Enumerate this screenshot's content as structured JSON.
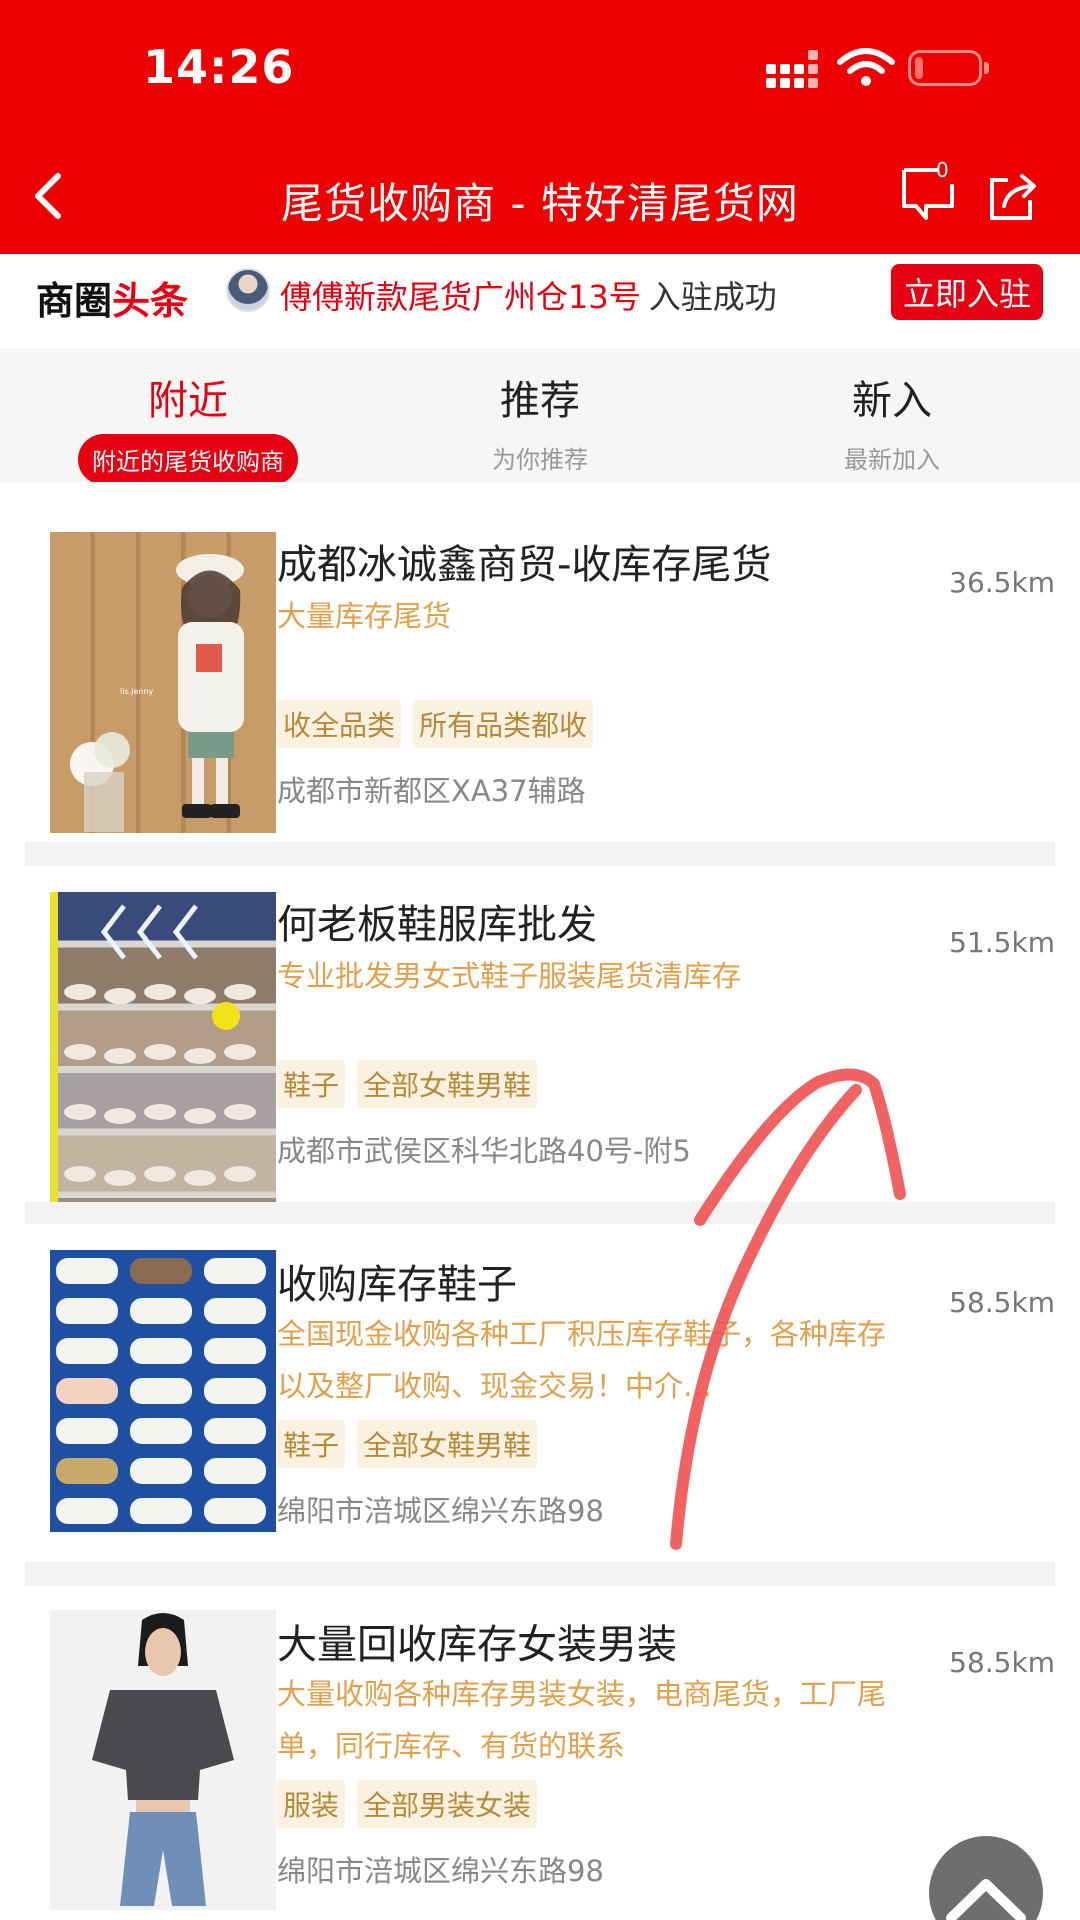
{
  "status": {
    "time": "14:26"
  },
  "header": {
    "title": "尾货收购商 - 特好清尾货网",
    "message_count": "0"
  },
  "ticker": {
    "brand_black": "商圈",
    "brand_red": "头条",
    "name": "傅傅新款尾货广州仓13号",
    "action": "入驻成功",
    "join_label": "立即入驻"
  },
  "tabs": [
    {
      "label": "附近",
      "sub": "附近的尾货收购商",
      "active": true
    },
    {
      "label": "推荐",
      "sub": "为你推荐",
      "active": false
    },
    {
      "label": "新入",
      "sub": "最新加入",
      "active": false
    }
  ],
  "listings": [
    {
      "name": "成都冰诚鑫商贸-收库存尾货",
      "distance": "36.5km",
      "desc": "大量库存尾货",
      "tags": [
        "收全品类",
        "所有品类都收"
      ],
      "address": "成都市新都区XA37辅路",
      "image_watermark": "lis.jenny"
    },
    {
      "name": "何老板鞋服库批发",
      "distance": "51.5km",
      "desc": "专业批发男女式鞋子服装尾货清库存",
      "tags": [
        "鞋子",
        "全部女鞋男鞋"
      ],
      "address": "成都市武侯区科华北路40号-附5"
    },
    {
      "name": "收购库存鞋子",
      "distance": "58.5km",
      "desc": "全国现金收购各种工厂积压库存鞋子，各种库存以及整厂收购、现金交易！中介…",
      "tags": [
        "鞋子",
        "全部女鞋男鞋"
      ],
      "address": "绵阳市涪城区绵兴东路98"
    },
    {
      "name": "大量回收库存女装男装",
      "distance": "58.5km",
      "desc": "大量收购各种库存男装女装，电商尾货，工厂尾单，同行库存、有货的联系",
      "tags": [
        "服装",
        "全部男装女装"
      ],
      "address": "绵阳市涪城区绵兴东路98"
    }
  ],
  "colors": {
    "brand": "#ee0000",
    "accent": "#e60012",
    "desc": "#e2a04a",
    "tag_bg": "#fbf1e1"
  }
}
